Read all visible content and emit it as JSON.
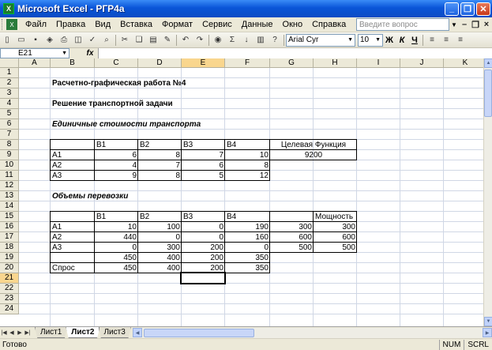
{
  "window": {
    "title": "Microsoft Excel - РГР4а",
    "app_icon": "X"
  },
  "menu": {
    "items": [
      "Файл",
      "Правка",
      "Вид",
      "Вставка",
      "Формат",
      "Сервис",
      "Данные",
      "Окно",
      "Справка"
    ],
    "ask_placeholder": "Введите вопрос"
  },
  "toolbar": {
    "font": "Arial Cyr",
    "size": "10",
    "bold": "Ж",
    "italic": "К",
    "underline": "Ч"
  },
  "formula": {
    "name_box": "E21",
    "fx": "fx",
    "value": ""
  },
  "columns": [
    "A",
    "B",
    "C",
    "D",
    "E",
    "F",
    "G",
    "H",
    "I",
    "J",
    "K",
    "L"
  ],
  "rows": [
    "1",
    "2",
    "3",
    "4",
    "5",
    "6",
    "7",
    "8",
    "9",
    "10",
    "11",
    "12",
    "13",
    "14",
    "15",
    "16",
    "17",
    "18",
    "19",
    "20",
    "21",
    "22",
    "23",
    "24"
  ],
  "cells": {
    "B2": "Расчетно-графическая работа №4",
    "B4": "Решение транспортной задачи",
    "B6": "Единичные стоимости транспорта",
    "C8": "B1",
    "D8": "B2",
    "E8": "B3",
    "F8": "B4",
    "G8": "Целевая Функция",
    "B9": "A1",
    "C9": "6",
    "D9": "8",
    "E9": "7",
    "F9": "10",
    "G9": "9200",
    "B10": "A2",
    "C10": "4",
    "D10": "7",
    "E10": "6",
    "F10": "8",
    "B11": "A3",
    "C11": "9",
    "D11": "8",
    "E11": "5",
    "F11": "12",
    "B13": "Объемы перевозки",
    "C15": "B1",
    "D15": "B2",
    "E15": "B3",
    "F15": "B4",
    "H15": "Мощность",
    "B16": "A1",
    "C16": "10",
    "D16": "100",
    "E16": "0",
    "F16": "190",
    "G16": "300",
    "H16": "300",
    "B17": "A2",
    "C17": "440",
    "D17": "0",
    "E17": "0",
    "F17": "160",
    "G17": "600",
    "H17": "600",
    "B18": "A3",
    "C18": "0",
    "D18": "300",
    "E18": "200",
    "F18": "0",
    "G18": "500",
    "H18": "500",
    "C19": "450",
    "D19": "400",
    "E19": "200",
    "F19": "350",
    "B20": "Спрос",
    "C20": "450",
    "D20": "400",
    "E20": "200",
    "F20": "350"
  },
  "sheets": [
    "Лист1",
    "Лист2",
    "Лист3"
  ],
  "active_sheet": "Лист2",
  "status": {
    "text": "Готово",
    "indicators": [
      "NUM",
      "SCRL"
    ]
  }
}
